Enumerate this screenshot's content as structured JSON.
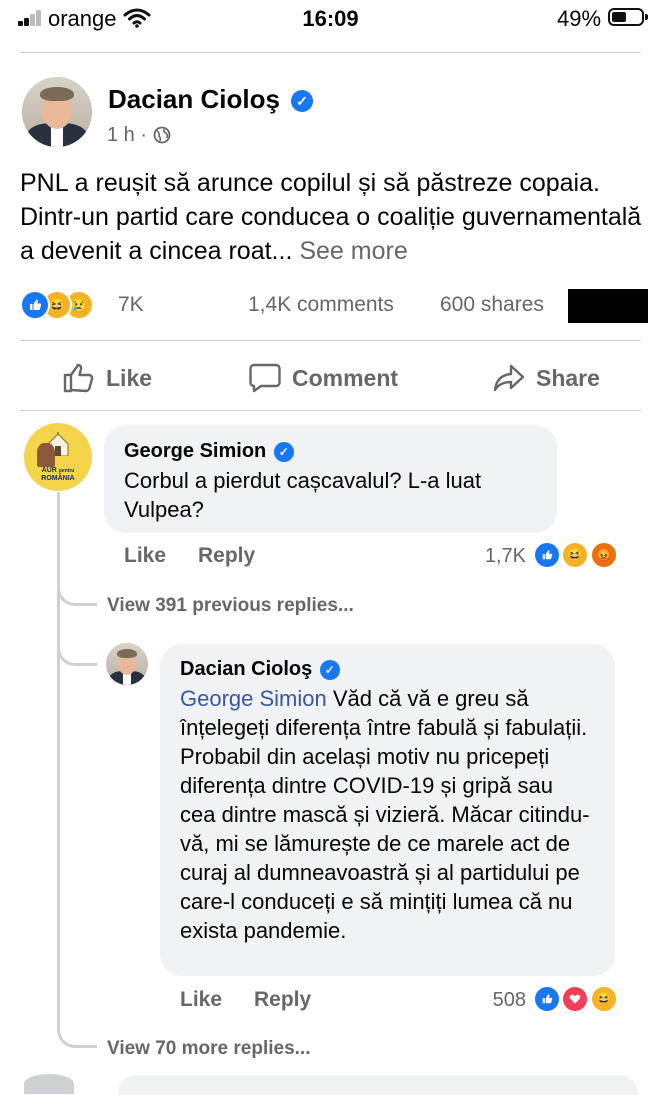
{
  "status_bar": {
    "carrier": "orange",
    "time": "16:09",
    "battery": "49%"
  },
  "post": {
    "author": "Dacian Cioloş",
    "time": "1 h",
    "separator": "·",
    "text": "PNL a reușit să arunce copilul și să păstreze copaia. Dintr-un partid care conducea o coaliție guvernamentală a devenit a cincea roat...",
    "see_more": "See more",
    "reaction_count": "7K",
    "comments_count": "1,4K comments",
    "shares_count": "600 shares"
  },
  "actions": {
    "like": "Like",
    "comment": "Comment",
    "share": "Share"
  },
  "comment1": {
    "author": "George Simion",
    "avatar_text": [
      "AUR",
      "pentru",
      "ROMÂNIA"
    ],
    "text": "Corbul a pierdut cașcavalul? L-a luat Vulpea?",
    "like": "Like",
    "reply": "Reply",
    "reaction_count": "1,7K"
  },
  "view_previous": "View 391 previous replies...",
  "reply1": {
    "author": "Dacian Cioloş",
    "mention": "George Simion",
    "text": "Văd că vă e greu să înțelegeți diferența între fabulă și fabulații. Probabil din același motiv nu pricepeți diferența dintre COVID-19 și gripă sau cea dintre mască și vizieră. Măcar citindu-vă, mi se lămurește de ce marele act de curaj al dumneavoastră și al partidului pe care-l conduceți e să mințiți lumea că nu exista pandemie.",
    "like": "Like",
    "reply": "Reply",
    "reaction_count": "508"
  },
  "view_more": "View 70 more replies...",
  "colors": {
    "accent": "#1877f2",
    "text_secondary": "#65676b",
    "bubble": "#f0f2f5",
    "love": "#f33e58",
    "haha": "#f7b125",
    "angry": "#e9710f"
  }
}
